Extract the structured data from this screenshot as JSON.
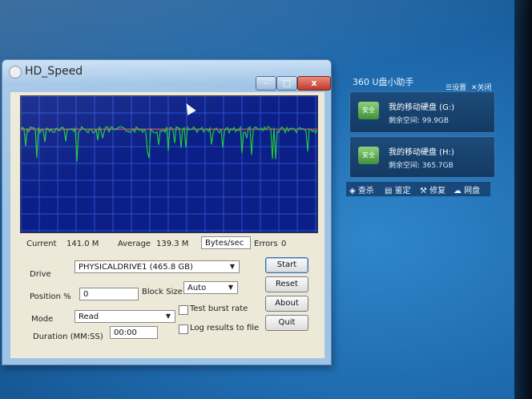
{
  "window": {
    "title": "HD_Speed",
    "close_glyph": "x",
    "min_glyph": "–",
    "max_glyph": "□"
  },
  "stats": {
    "current_label": "Current",
    "current_value": "141.0 M",
    "average_label": "Average",
    "average_value": "139.3 M",
    "unit_select": "Bytes/sec",
    "errors_label": "Errors",
    "errors_value": "0"
  },
  "form": {
    "drive_label": "Drive",
    "drive_value": "PHYSICALDRIVE1 (465.8 GB)",
    "position_label": "Position %",
    "position_value": "0",
    "block_size_label": "Block Size",
    "block_size_value": "Auto",
    "mode_label": "Mode",
    "mode_value": "Read",
    "duration_label": "Duration (MM:SS)",
    "duration_value": "00:00",
    "test_burst_label": "Test burst rate",
    "log_results_label": "Log results to file"
  },
  "buttons": {
    "start": "Start",
    "reset": "Reset",
    "about": "About",
    "quit": "Quit"
  },
  "panel360": {
    "title": "360 U盘小助手",
    "settings_link": "设置",
    "close_link": "关闭",
    "drives": [
      {
        "name": "我的移动硬盘 (G:)",
        "space": "剩余空间: 99.9GB",
        "icon_text": "安全"
      },
      {
        "name": "我的移动硬盘 (H:)",
        "space": "剩余空间: 365.7GB",
        "icon_text": "安全"
      }
    ],
    "tools": [
      "查杀",
      "鉴定",
      "修复",
      "网盘"
    ]
  },
  "colors": {
    "graph_bg": "#0b1f86",
    "graph_grid": "#2b4fd0",
    "graph_line": "#22c93a",
    "graph_red": "#ff3b3b"
  }
}
